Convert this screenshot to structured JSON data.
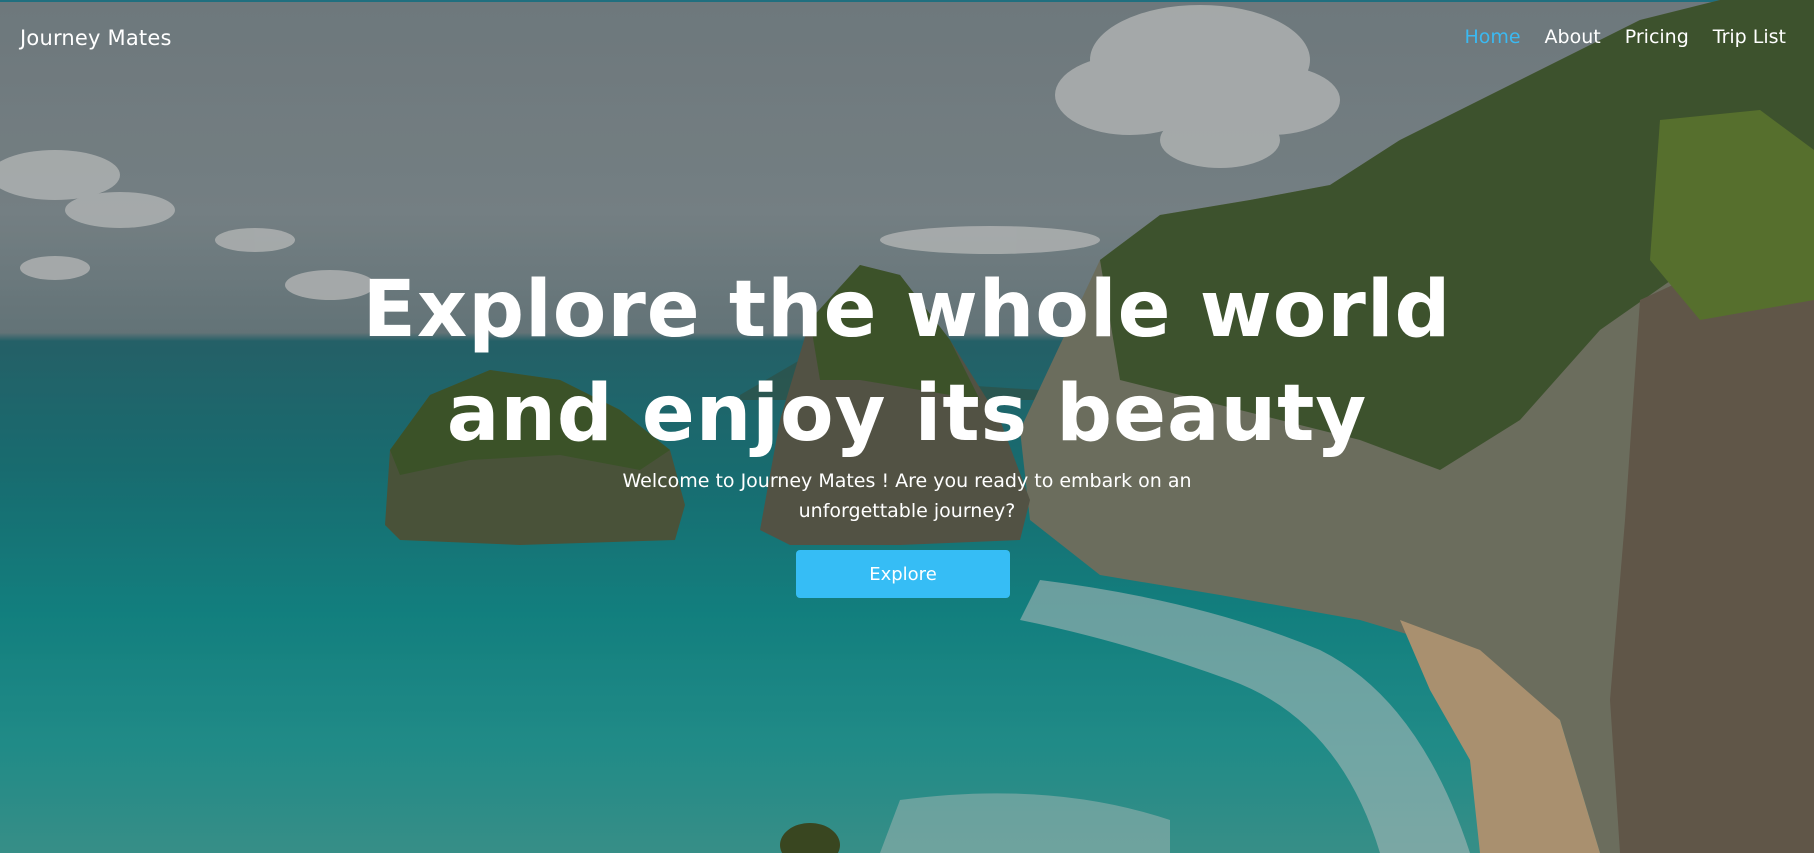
{
  "brand": {
    "name": "Journey Mates"
  },
  "nav": {
    "items": [
      {
        "label": "Home",
        "active": true
      },
      {
        "label": "About",
        "active": false
      },
      {
        "label": "Pricing",
        "active": false
      },
      {
        "label": "Trip List",
        "active": false
      }
    ]
  },
  "hero": {
    "title_line1": "Explore the whole world",
    "title_line2": "and enjoy its beauty",
    "subtitle_line1": "Welcome to Journey Mates ! Are you ready to embark on an",
    "subtitle_line2": "unforgettable journey?",
    "cta_label": "Explore",
    "background": "coastal cliffs, turquoise sea and sea stacks"
  },
  "colors": {
    "accent": "#36bdf5",
    "nav_active": "#3bb9f1",
    "text": "#ffffff"
  }
}
